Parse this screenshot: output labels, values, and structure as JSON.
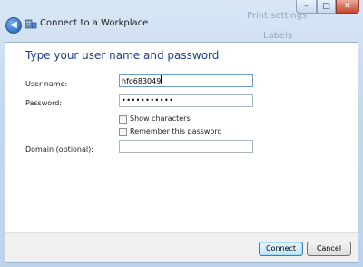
{
  "window": {
    "title": "Connect to a Workplace",
    "background_hints": [
      "Print settings",
      "Labels"
    ],
    "controls": {
      "minimize": "–",
      "maximize": "□",
      "close": "✕"
    }
  },
  "main": {
    "heading": "Type your user name and password",
    "username": {
      "label": "User name:",
      "value": "hfo683049"
    },
    "password": {
      "label": "Password:",
      "value": "•••••••••••"
    },
    "show_characters": {
      "label": "Show characters",
      "checked": false
    },
    "remember_password": {
      "label": "Remember this password",
      "checked": false
    },
    "domain": {
      "label": "Domain (optional):",
      "value": ""
    }
  },
  "footer": {
    "connect_label": "Connect",
    "cancel_label": "Cancel"
  },
  "colors": {
    "heading": "#1d3f8c",
    "close_button": "#c7452b",
    "primary_button": "#bee6fd"
  },
  "icons": {
    "back": "back-arrow-icon",
    "app": "workplace-network-icon"
  }
}
